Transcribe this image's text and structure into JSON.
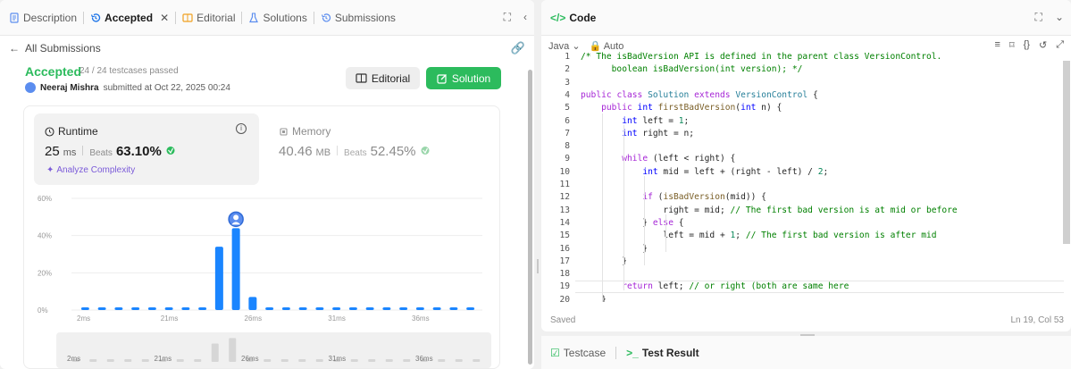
{
  "tabs": [
    {
      "label": "Description"
    },
    {
      "label": "Accepted"
    },
    {
      "label": "Editorial"
    },
    {
      "label": "Solutions"
    },
    {
      "label": "Submissions"
    }
  ],
  "back_label": "All Submissions",
  "submission": {
    "status": "Accepted",
    "testcases": "24 / 24 testcases passed",
    "author": "Neeraj Mishra",
    "submitted_text": "submitted at Oct 22, 2025 00:24",
    "editorial_btn": "Editorial",
    "solution_btn": "Solution"
  },
  "runtime": {
    "title": "Runtime",
    "value": "25",
    "unit": "ms",
    "beats_label": "Beats",
    "beats_pct": "63.10%",
    "analyze": "Analyze Complexity"
  },
  "memory": {
    "title": "Memory",
    "value": "40.46",
    "unit": "MB",
    "beats_label": "Beats",
    "beats_pct": "52.45%"
  },
  "chart_data": {
    "type": "bar",
    "ylim": [
      0,
      60
    ],
    "yticks": [
      "0%",
      "20%",
      "40%",
      "60%"
    ],
    "xticks": [
      "2ms",
      "21ms",
      "26ms",
      "31ms",
      "36ms"
    ],
    "values": [
      0.3,
      0.3,
      0.3,
      0.3,
      0.3,
      0.3,
      0.3,
      0.3,
      34,
      44,
      7,
      0.3,
      0.3,
      0.3,
      0.3,
      0.3,
      0.3,
      0.3,
      0.3,
      0.3,
      0.3,
      0.3,
      0.3,
      0.3
    ],
    "highlight_index": 9,
    "scrubber_xticks": [
      "2ms",
      "21ms",
      "26ms",
      "31ms",
      "36ms"
    ],
    "bar_color": "#1a85ff",
    "grid": true
  },
  "code": {
    "title": "Code",
    "language": "Java",
    "mode": "Auto",
    "saved": "Saved",
    "cursor": "Ln 19, Col 53",
    "lines": [
      "/* The isBadVersion API is defined in the parent class VersionControl.",
      "      boolean isBadVersion(int version); */",
      "",
      "public class Solution extends VersionControl {",
      "    public int firstBadVersion(int n) {",
      "        int left = 1;",
      "        int right = n;",
      "",
      "        while (left < right) {",
      "            int mid = left + (right - left) / 2;",
      "",
      "            if (isBadVersion(mid)) {",
      "                right = mid; // The first bad version is at mid or before",
      "            } else {",
      "                left = mid + 1; // The first bad version is after mid",
      "            }",
      "        }",
      "",
      "        return left; // or right (both are same here",
      "    }"
    ]
  },
  "bottom": {
    "testcase": "Testcase",
    "test_result": "Test Result"
  }
}
